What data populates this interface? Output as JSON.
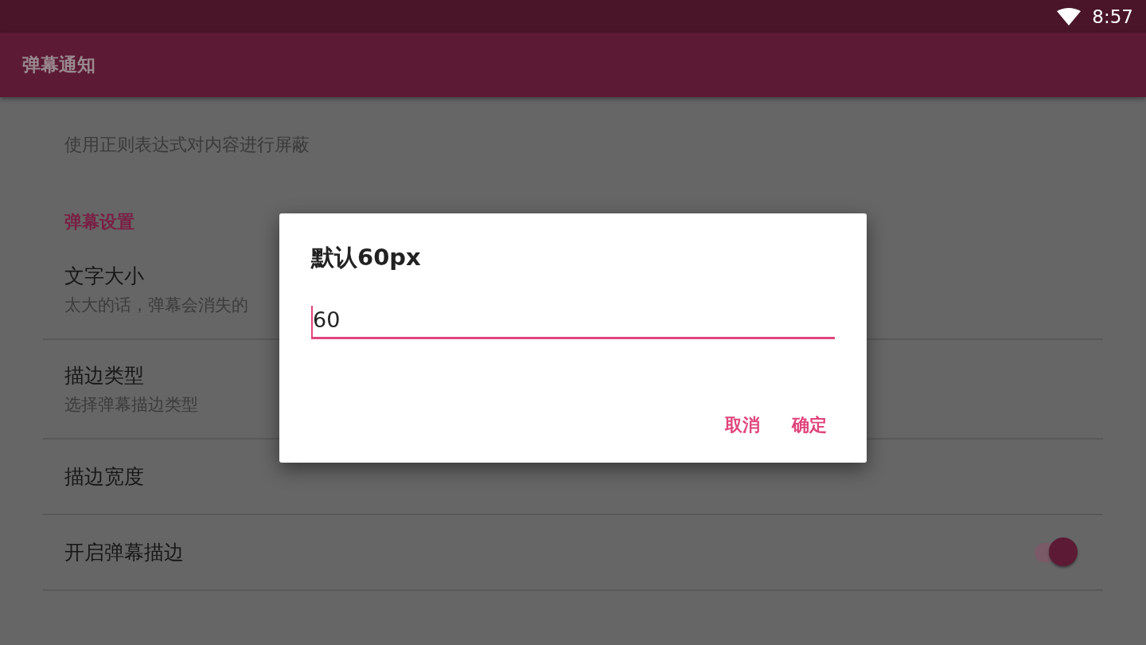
{
  "status_bar": {
    "time": "8:57"
  },
  "app_bar": {
    "title": "弹幕通知"
  },
  "settings": [
    {
      "kind": "summary",
      "title": "使用正则表达式对内容进行屏蔽"
    },
    {
      "kind": "header",
      "title": "弹幕设置"
    },
    {
      "kind": "item",
      "title": "文字大小",
      "subtitle": "太大的话，弹幕会消失的"
    },
    {
      "kind": "item",
      "title": "描边类型",
      "subtitle": "选择弹幕描边类型"
    },
    {
      "kind": "item",
      "title": "描边宽度"
    },
    {
      "kind": "switch",
      "title": "开启弹幕描边",
      "on": true
    }
  ],
  "dialog": {
    "title": "默认60px",
    "value": "60",
    "buttons": [
      "取消",
      "确定"
    ]
  }
}
